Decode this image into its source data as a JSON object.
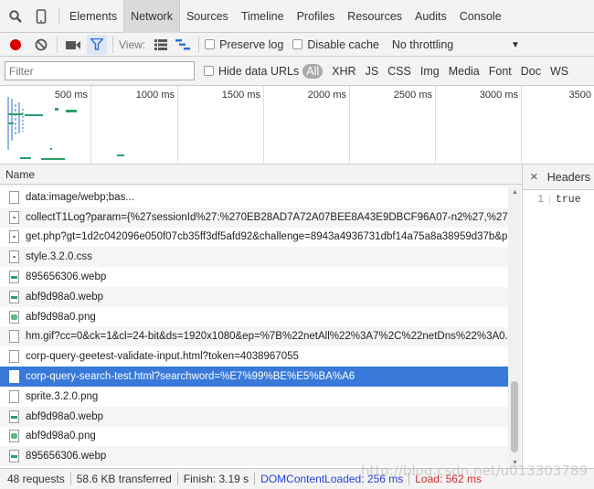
{
  "tabs": [
    "Elements",
    "Network",
    "Sources",
    "Timeline",
    "Profiles",
    "Resources",
    "Audits",
    "Console"
  ],
  "active_tab": "Network",
  "toolbar": {
    "view_label": "View:",
    "preserve_log": "Preserve log",
    "disable_cache": "Disable cache",
    "throttling": "No throttling"
  },
  "filter": {
    "placeholder": "Filter",
    "hide_data_urls": "Hide data URLs",
    "types": [
      "All",
      "XHR",
      "JS",
      "CSS",
      "Img",
      "Media",
      "Font",
      "Doc",
      "WS"
    ]
  },
  "overview": {
    "ticks": [
      "500 ms",
      "1000 ms",
      "1500 ms",
      "2000 ms",
      "2500 ms",
      "3000 ms",
      "3500"
    ]
  },
  "grid": {
    "column_name": "Name",
    "rows": [
      {
        "name": "data:image/webp;bas...",
        "icon": "generic"
      },
      {
        "name": "collectT1Log?param={%27sessionId%27:%270EB28AD7A72A07BEE8A43E9DBCF96A07-n2%27,%27referer...",
        "icon": "doc"
      },
      {
        "name": "get.php?gt=1d2c042096e050f07cb35ff3df5afd92&challenge=8943a4936731dbf14a75a8a38959d37b&pro...",
        "icon": "doc"
      },
      {
        "name": "style.3.2.0.css",
        "icon": "doc"
      },
      {
        "name": "895656306.webp",
        "icon": "img"
      },
      {
        "name": "abf9d98a0.webp",
        "icon": "img"
      },
      {
        "name": "abf9d98a0.png",
        "icon": "png"
      },
      {
        "name": "hm.gif?cc=0&ck=1&cl=24-bit&ds=1920x1080&ep=%7B%22netAll%22%3A7%2C%22netDns%22%3A0...",
        "icon": "generic"
      },
      {
        "name": "corp-query-geetest-validate-input.html?token=4038967055",
        "icon": "generic"
      },
      {
        "name": "corp-query-search-test.html?searchword=%E7%99%BE%E5%BA%A6",
        "icon": "generic",
        "selected": true
      },
      {
        "name": "sprite.3.2.0.png",
        "icon": "generic"
      },
      {
        "name": "abf9d98a0.webp",
        "icon": "img"
      },
      {
        "name": "abf9d98a0.png",
        "icon": "png"
      },
      {
        "name": "895656306.webp",
        "icon": "img"
      }
    ]
  },
  "side_panel": {
    "close": "×",
    "tab": "Headers",
    "line_number": "1",
    "content": "true"
  },
  "status": {
    "requests": "48 requests",
    "transferred": "58.6 KB transferred",
    "finish": "Finish: 3.19 s",
    "dom_loaded": "DOMContentLoaded: 256 ms",
    "load": "Load: 562 ms"
  },
  "watermark": "http://blog.csdn.net/u013303789",
  "colors": {
    "dom_loaded": "#2242d8",
    "load": "#d22b2b",
    "selected_row": "#3879d9",
    "record_button": "#d50000"
  }
}
